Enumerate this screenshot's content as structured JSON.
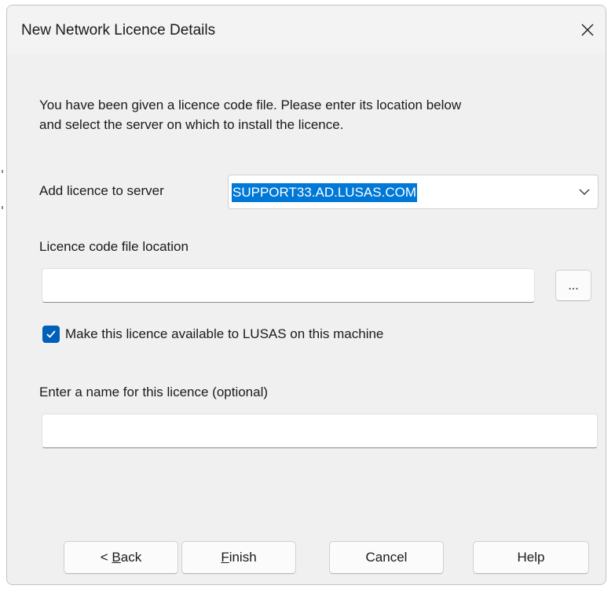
{
  "dialog": {
    "title": "New Network Licence Details",
    "close_icon": "close-icon"
  },
  "intro": {
    "line1": "You have been given a licence code file. Please enter its location below",
    "line2": "and select the server on which to install the licence."
  },
  "server": {
    "label": "Add licence to server",
    "selected_value": "SUPPORT33.AD.LUSAS.COM",
    "dropdown_icon": "chevron-down-icon"
  },
  "licence_file": {
    "label": "Licence code file location",
    "value": "",
    "browse_label": "..."
  },
  "availability": {
    "checked": true,
    "label": "Make this licence available to LUSAS on this machine"
  },
  "licence_name": {
    "label": "Enter a name for this licence (optional)",
    "value": ""
  },
  "buttons": {
    "back_prefix": "< ",
    "back_mnemonic": "B",
    "back_rest": "ack",
    "finish_mnemonic": "F",
    "finish_rest": "inish",
    "cancel": "Cancel",
    "help": "Help"
  },
  "colors": {
    "accent": "#005fb8",
    "selection": "#0078d7",
    "dialog_bg": "#f0f0f0"
  }
}
